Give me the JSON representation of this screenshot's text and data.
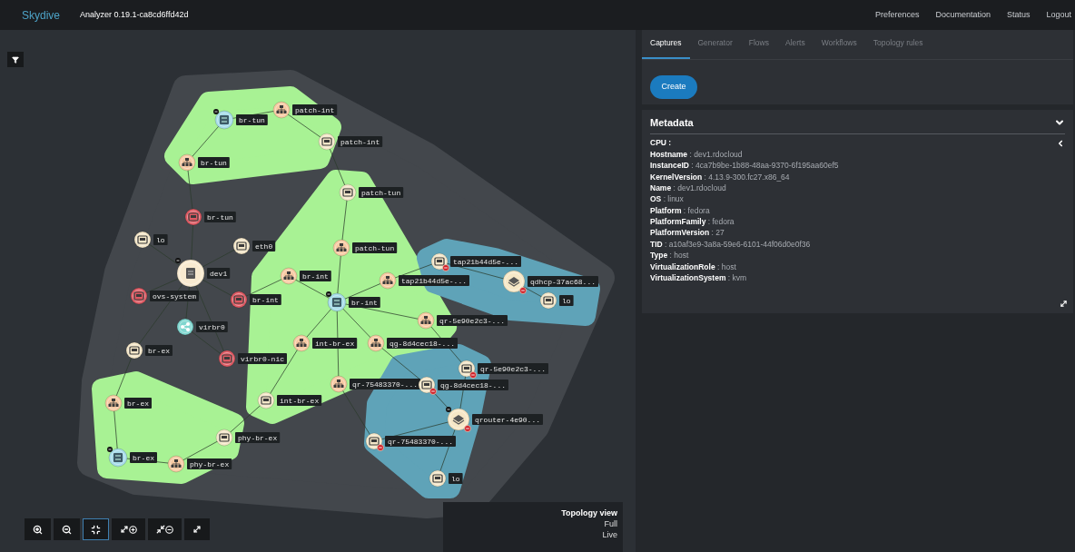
{
  "header": {
    "brand": "Skydive",
    "version": "Analyzer 0.19.1-ca8cd6ffd42d",
    "links": [
      "Preferences",
      "Documentation",
      "Status",
      "Logout"
    ]
  },
  "topology": {
    "nodes": [
      {
        "kind": "switch",
        "label": "br-tun",
        "toggle": true,
        "alert": false
      },
      {
        "kind": "bridge",
        "label": "patch-int",
        "toggle": false,
        "alert": false
      },
      {
        "kind": "interface",
        "label": "patch-int",
        "toggle": false,
        "alert": false
      },
      {
        "kind": "bridge",
        "label": "br-tun",
        "toggle": false,
        "alert": false
      },
      {
        "kind": "interface",
        "label": "patch-tun",
        "toggle": false,
        "alert": false
      },
      {
        "kind": "down",
        "label": "br-tun",
        "toggle": false,
        "alert": false
      },
      {
        "kind": "interface",
        "label": "lo",
        "toggle": false,
        "alert": false
      },
      {
        "kind": "interface",
        "label": "eth0",
        "toggle": false,
        "alert": false
      },
      {
        "kind": "host",
        "label": "dev1",
        "toggle": true,
        "alert": false
      },
      {
        "kind": "bridge",
        "label": "patch-tun",
        "toggle": false,
        "alert": false
      },
      {
        "kind": "bridge",
        "label": "br-int",
        "toggle": false,
        "alert": false
      },
      {
        "kind": "down",
        "label": "ovs-system",
        "toggle": false,
        "alert": false
      },
      {
        "kind": "down",
        "label": "br-int",
        "toggle": false,
        "alert": false
      },
      {
        "kind": "switch",
        "label": "br-int",
        "toggle": true,
        "alert": false
      },
      {
        "kind": "bridge",
        "label": "tap21b44d5e-...",
        "toggle": false,
        "alert": false
      },
      {
        "kind": "interface",
        "label": "tap21b44d5e-...",
        "toggle": false,
        "alert": true
      },
      {
        "kind": "namespace",
        "label": "qdhcp-37ac68...",
        "toggle": false,
        "alert": true
      },
      {
        "kind": "interface",
        "label": "lo",
        "toggle": false,
        "alert": false
      },
      {
        "kind": "network",
        "label": "virbr0",
        "toggle": false,
        "alert": false
      },
      {
        "kind": "bridge",
        "label": "qr-5e90e2c3-...",
        "toggle": false,
        "alert": false
      },
      {
        "kind": "bridge",
        "label": "int-br-ex",
        "toggle": false,
        "alert": false
      },
      {
        "kind": "bridge",
        "label": "qg-8d4cec18-...",
        "toggle": false,
        "alert": false
      },
      {
        "kind": "down",
        "label": "virbr0-nic",
        "toggle": false,
        "alert": false
      },
      {
        "kind": "interface",
        "label": "br-ex",
        "toggle": false,
        "alert": false
      },
      {
        "kind": "interface",
        "label": "qr-5e90e2c3-...",
        "toggle": false,
        "alert": true
      },
      {
        "kind": "bridge",
        "label": "qr-75483370-...",
        "toggle": false,
        "alert": false
      },
      {
        "kind": "interface",
        "label": "qg-8d4cec18-...",
        "toggle": false,
        "alert": true
      },
      {
        "kind": "interface",
        "label": "int-br-ex",
        "toggle": false,
        "alert": false
      },
      {
        "kind": "bridge",
        "label": "br-ex",
        "toggle": false,
        "alert": false
      },
      {
        "kind": "namespace",
        "label": "qrouter-4e90...",
        "toggle": true,
        "alert": true
      },
      {
        "kind": "interface",
        "label": "phy-br-ex",
        "toggle": false,
        "alert": false
      },
      {
        "kind": "interface",
        "label": "qr-75483370-...",
        "toggle": false,
        "alert": true
      },
      {
        "kind": "switch",
        "label": "br-ex",
        "toggle": true,
        "alert": false
      },
      {
        "kind": "bridge",
        "label": "phy-br-ex",
        "toggle": false,
        "alert": false
      },
      {
        "kind": "interface",
        "label": "lo",
        "toggle": false,
        "alert": false
      }
    ],
    "toolbar": [
      {
        "kind": "zoom-in",
        "selected": false
      },
      {
        "kind": "zoom-out",
        "selected": false
      },
      {
        "kind": "fit",
        "selected": true
      },
      {
        "kind": "expand",
        "selected": false
      },
      {
        "kind": "collapse",
        "selected": false
      },
      {
        "kind": "pin",
        "selected": false
      }
    ],
    "view": {
      "title": "Topology view",
      "lines": [
        "Full",
        "Live"
      ]
    }
  },
  "tabs": [
    {
      "label": "Captures",
      "selected": true
    },
    {
      "label": "Generator",
      "selected": false
    },
    {
      "label": "Flows",
      "selected": false
    },
    {
      "label": "Alerts",
      "selected": false
    },
    {
      "label": "Workflows",
      "selected": false
    },
    {
      "label": "Topology rules",
      "selected": false
    }
  ],
  "create_button": "Create",
  "metadata": {
    "title": "Metadata",
    "expanded": true,
    "rows": [
      {
        "text": "**CPU :**",
        "expanded": false
      },
      {
        "text": "**Hostname** : dev1.rdocloud"
      },
      {
        "text": "**InstanceID** : 4ca7b9be-1b88-48aa-9370-6f195aa60ef5"
      },
      {
        "text": "**KernelVersion** : 4.13.9-300.fc27.x86_64"
      },
      {
        "text": "**Name** : dev1.rdocloud"
      },
      {
        "text": "**OS** : linux"
      },
      {
        "text": "**Platform** : fedora"
      },
      {
        "text": "**PlatformFamily** : fedora"
      },
      {
        "text": "**PlatformVersion** : 27"
      },
      {
        "text": "**TID** : a10af3e9-3a8a-59e6-6101-44f06d0e0f36"
      },
      {
        "text": "**Type** : host"
      },
      {
        "text": "**VirtualizationRole** : host"
      },
      {
        "text": "**VirtualizationSystem** : kvm"
      }
    ]
  }
}
